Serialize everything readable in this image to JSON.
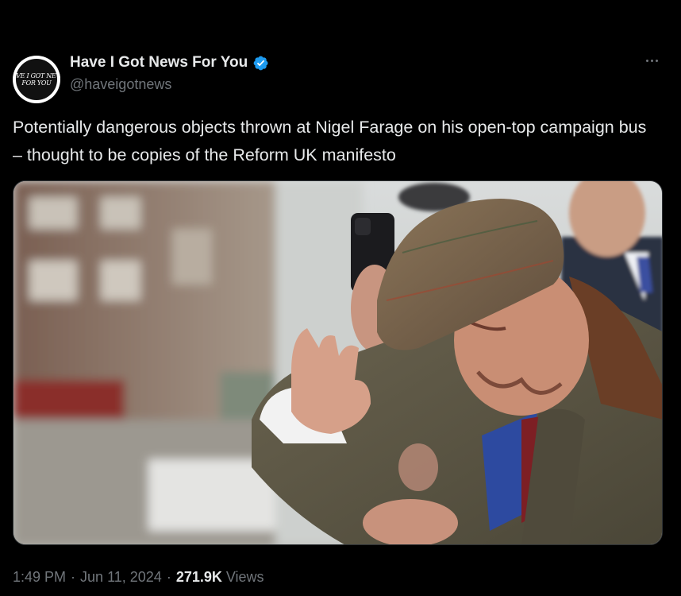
{
  "account": {
    "display_name": "Have I Got News For You",
    "handle": "@haveigotnews",
    "avatar_text": [
      "HAVE I GOT NEWS",
      "FOR YOU"
    ],
    "verified": true
  },
  "tweet": {
    "text": "Potentially dangerous objects thrown at Nigel Farage on his open-top campaign bus – thought to be copies of the Reform UK manifesto"
  },
  "meta": {
    "time": "1:49 PM",
    "separator": "·",
    "date": "Jun 11, 2024",
    "views_count": "271.9K",
    "views_label": "Views"
  },
  "colors": {
    "background": "#000000",
    "text_primary": "#e7e9ea",
    "text_secondary": "#71767b",
    "verified_badge": "#1d9bf0",
    "border": "#2f3336"
  },
  "icons": {
    "verified": "verified-badge-icon",
    "more": "more-options-icon"
  }
}
